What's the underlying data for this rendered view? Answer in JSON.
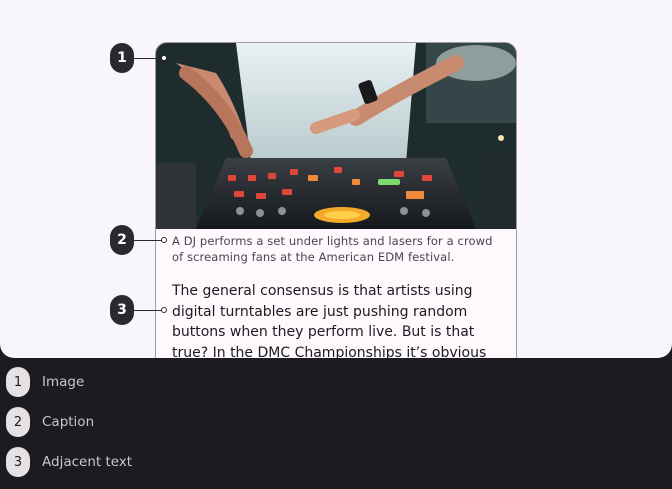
{
  "image_alt_icon": "dj-turntable-photo",
  "caption": "A DJ performs a set under lights and lasers for a crowd of screaming fans at the American EDM festival.",
  "adjacent_text": "The general consensus is that artists using digital turntables are just pushing random buttons when they perform live. But is that true? In the DMC Championships it’s obvious that some artists are",
  "markers": [
    "1",
    "2",
    "3"
  ],
  "legend": [
    {
      "number": "1",
      "label": "Image"
    },
    {
      "number": "2",
      "label": "Caption"
    },
    {
      "number": "3",
      "label": "Adjacent text"
    }
  ]
}
